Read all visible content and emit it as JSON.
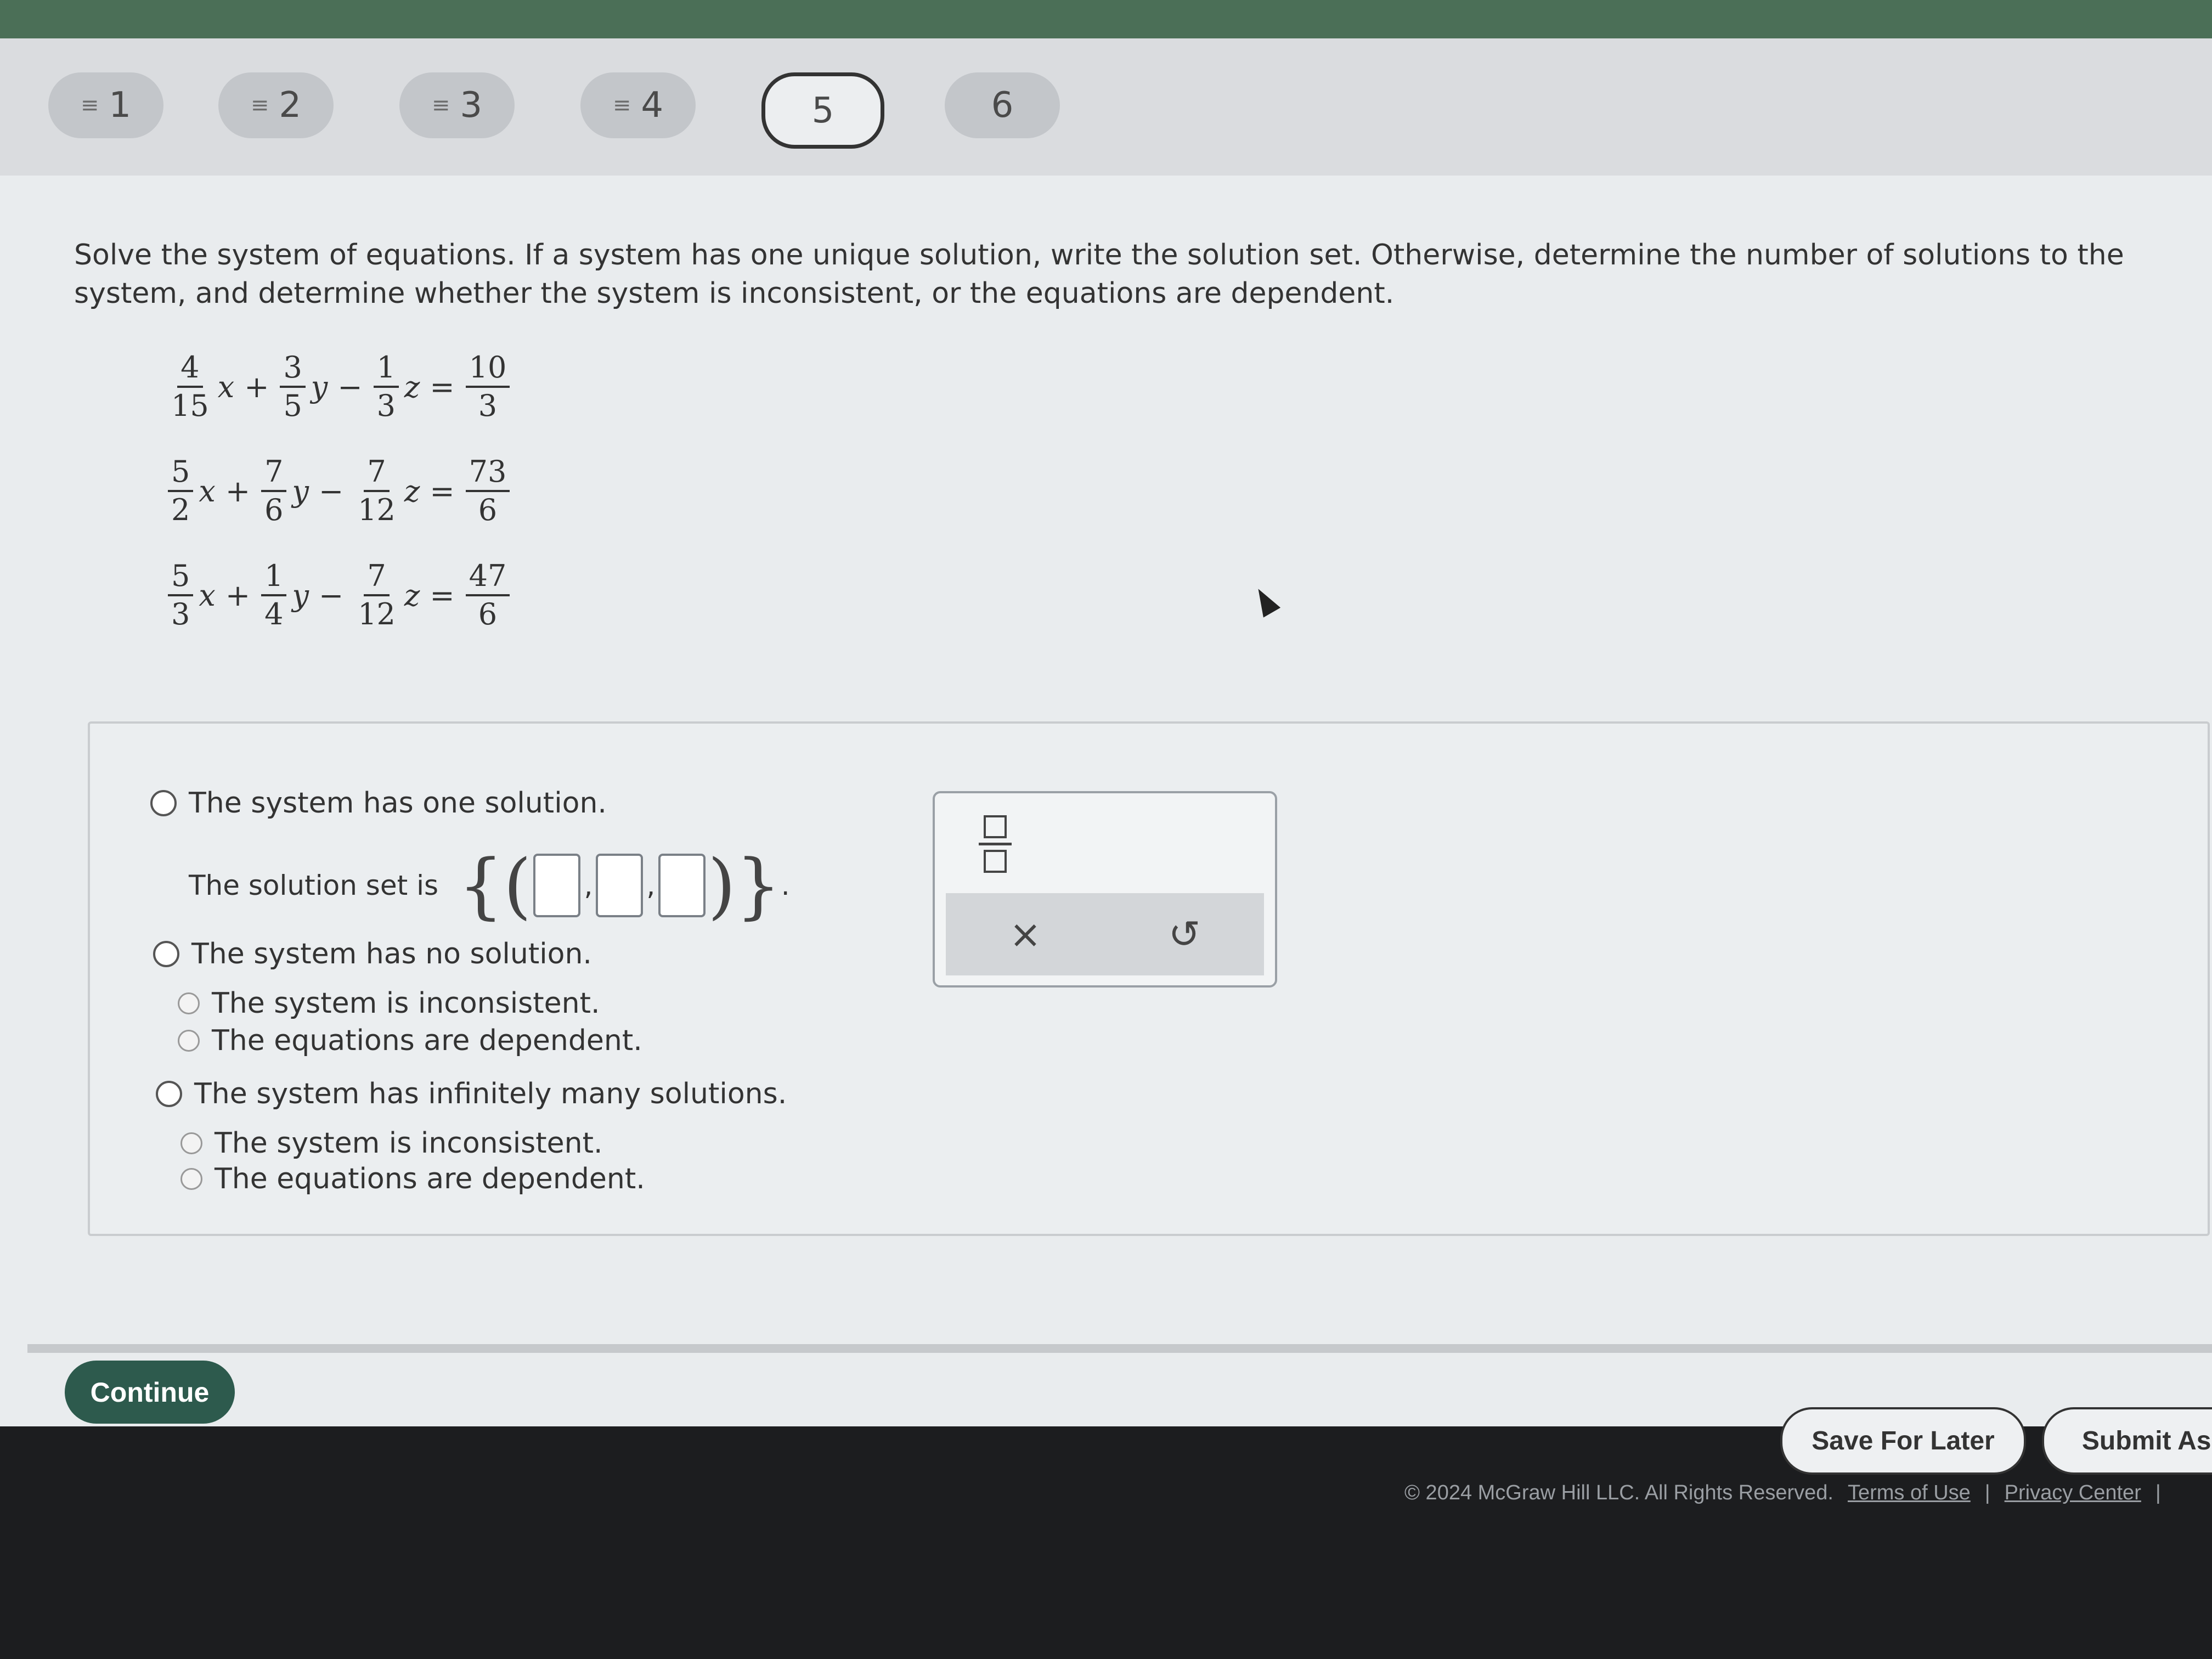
{
  "question_nav": [
    {
      "label": "1",
      "done_icon": "≡"
    },
    {
      "label": "2",
      "done_icon": "≡"
    },
    {
      "label": "3",
      "done_icon": "≡"
    },
    {
      "label": "4",
      "done_icon": "≡"
    },
    {
      "label": "5",
      "done_icon": ""
    },
    {
      "label": "6",
      "done_icon": ""
    }
  ],
  "prompt": "Solve the system of equations. If a system has one unique solution, write the solution set. Otherwise, determine the number of solutions to the system, and determine whether the system is inconsistent, or the equations are dependent.",
  "equations": [
    {
      "a": [
        "4",
        "15"
      ],
      "b": [
        "3",
        "5"
      ],
      "c": [
        "1",
        "3"
      ],
      "rhs": [
        "10",
        "3"
      ]
    },
    {
      "a": [
        "5",
        "2"
      ],
      "b": [
        "7",
        "6"
      ],
      "c": [
        "7",
        "12"
      ],
      "rhs": [
        "73",
        "6"
      ]
    },
    {
      "a": [
        "5",
        "3"
      ],
      "b": [
        "1",
        "4"
      ],
      "c": [
        "7",
        "12"
      ],
      "rhs": [
        "47",
        "6"
      ]
    }
  ],
  "vars": {
    "x": "x",
    "y": "y",
    "z": "z",
    "plus": "+",
    "minus": "−",
    "eq": "="
  },
  "options": {
    "one": "The system has one solution.",
    "solution_set": "The solution set is",
    "none": "The system has no solution.",
    "none_a": "The system is inconsistent.",
    "none_b": "The equations are dependent.",
    "inf": "The system has infinitely many solutions.",
    "inf_a": "The system is inconsistent.",
    "inf_b": "The equations are dependent."
  },
  "keypad": {
    "clear": "×",
    "undo": "↺"
  },
  "buttons": {
    "continue": "Continue",
    "save": "Save For Later",
    "submit": "Submit Ass"
  },
  "footer": {
    "copyright": "© 2024 McGraw Hill LLC. All Rights Reserved.",
    "terms": "Terms of Use",
    "sep": "|",
    "privacy": "Privacy Center",
    "sep2": "|"
  }
}
